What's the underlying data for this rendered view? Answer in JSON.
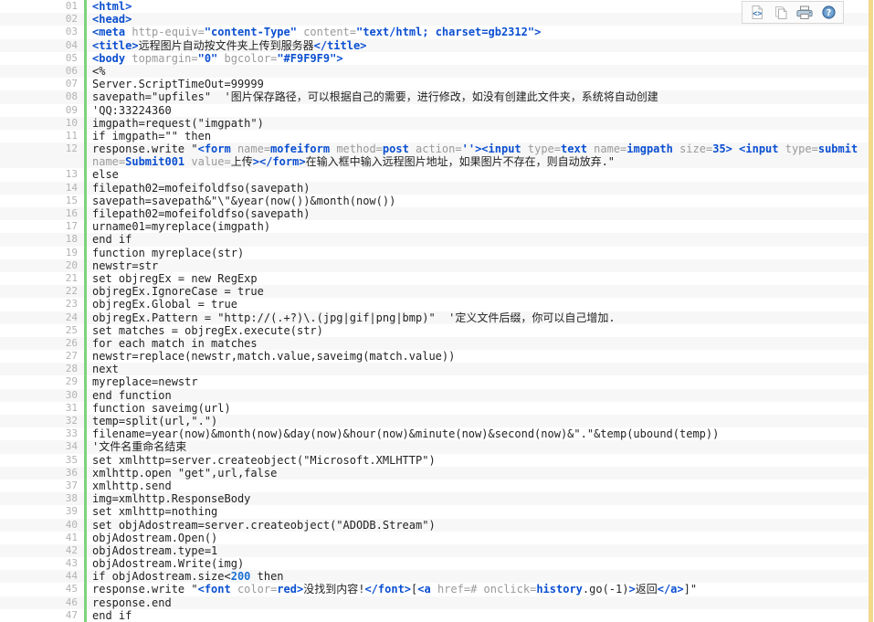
{
  "toolbar": {
    "buttons": [
      {
        "name": "view-source-icon",
        "label": "View Source",
        "glyph": "code-page-icon"
      },
      {
        "name": "copy-icon",
        "label": "Copy",
        "glyph": "copy-pages-icon"
      },
      {
        "name": "print-icon",
        "label": "Print",
        "glyph": "printer-icon"
      },
      {
        "name": "help-icon",
        "label": "Help",
        "glyph": "question-circle-icon"
      }
    ]
  },
  "colors": {
    "edge_bar": "#f2d98c",
    "gutter_accent": "#7ed37e",
    "line_number": "#b3b3b3",
    "row_alt": "#f7f7f7",
    "tag": "#0b4fd1",
    "attribute": "#9a9a9a",
    "value": "#0b4fd1",
    "number": "#1a6fd4",
    "text": "#222222"
  },
  "code": {
    "language": "asp-vbscript",
    "first_line": 1,
    "last_line": 47,
    "lines": [
      {
        "n": "01",
        "tokens": [
          {
            "t": "tag",
            "s": "<html>"
          }
        ]
      },
      {
        "n": "02",
        "tokens": [
          {
            "t": "tag",
            "s": "<head>"
          }
        ]
      },
      {
        "n": "03",
        "tokens": [
          {
            "t": "tag",
            "s": "<meta"
          },
          {
            "t": "attr",
            "s": " http-equiv="
          },
          {
            "t": "val",
            "s": "\"content-Type\""
          },
          {
            "t": "attr",
            "s": " content="
          },
          {
            "t": "val",
            "s": "\"text/html; charset=gb2312\""
          },
          {
            "t": "tag",
            "s": ">"
          }
        ]
      },
      {
        "n": "04",
        "tokens": [
          {
            "t": "tag",
            "s": "<title>"
          },
          {
            "t": "plain",
            "s": "远程图片自动按文件夹上传到服务器"
          },
          {
            "t": "tag",
            "s": "</title>"
          }
        ]
      },
      {
        "n": "05",
        "tokens": [
          {
            "t": "tag",
            "s": "<body"
          },
          {
            "t": "attr",
            "s": " topmargin="
          },
          {
            "t": "val",
            "s": "\"0\""
          },
          {
            "t": "attr",
            "s": " bgcolor="
          },
          {
            "t": "val",
            "s": "\"#F9F9F9\""
          },
          {
            "t": "tag",
            "s": ">"
          }
        ]
      },
      {
        "n": "06",
        "tokens": [
          {
            "t": "plain",
            "s": "<%"
          }
        ]
      },
      {
        "n": "07",
        "tokens": [
          {
            "t": "plain",
            "s": "Server.ScriptTimeOut=99999"
          }
        ]
      },
      {
        "n": "08",
        "tokens": [
          {
            "t": "plain",
            "s": "savepath=\"upfiles\"  '图片保存路径，可以根据自己的需要，进行修改，如没有创建此文件夹，系统将自动创建"
          }
        ]
      },
      {
        "n": "09",
        "tokens": [
          {
            "t": "plain",
            "s": "'QQ:33224360"
          }
        ]
      },
      {
        "n": "10",
        "tokens": [
          {
            "t": "plain",
            "s": "imgpath=request(\"imgpath\")"
          }
        ]
      },
      {
        "n": "11",
        "tokens": [
          {
            "t": "plain",
            "s": "if imgpath=\"\" then"
          }
        ]
      },
      {
        "n": "12",
        "wrapped": true,
        "tokens": [
          {
            "t": "plain",
            "s": "response.write \""
          },
          {
            "t": "tag",
            "s": "<form"
          },
          {
            "t": "attr",
            "s": " name="
          },
          {
            "t": "val",
            "s": "mofeiform"
          },
          {
            "t": "attr",
            "s": " method="
          },
          {
            "t": "val",
            "s": "post"
          },
          {
            "t": "attr",
            "s": " action="
          },
          {
            "t": "val",
            "s": "''"
          },
          {
            "t": "tag",
            "s": ">"
          },
          {
            "t": "tag",
            "s": "<input"
          },
          {
            "t": "attr",
            "s": " type="
          },
          {
            "t": "val",
            "s": "text"
          },
          {
            "t": "attr",
            "s": " name="
          },
          {
            "t": "val",
            "s": "imgpath"
          },
          {
            "t": "attr",
            "s": " size="
          },
          {
            "t": "val",
            "s": "35"
          },
          {
            "t": "tag",
            "s": ">"
          },
          {
            "t": "plain",
            "s": " "
          },
          {
            "t": "tag",
            "s": "<input"
          },
          {
            "t": "attr",
            "s": " type="
          },
          {
            "t": "val",
            "s": "submit"
          },
          {
            "t": "attr",
            "s": " name="
          },
          {
            "t": "val",
            "s": "Submit001"
          },
          {
            "t": "attr",
            "s": " value="
          },
          {
            "t": "plain",
            "s": "上传"
          },
          {
            "t": "tag",
            "s": ">"
          },
          {
            "t": "tag",
            "s": "</form>"
          },
          {
            "t": "plain",
            "s": "在输入框中输入远程图片地址，如果图片不存在，则自动放弃.\""
          }
        ]
      },
      {
        "n": "13",
        "tokens": [
          {
            "t": "plain",
            "s": "else"
          }
        ]
      },
      {
        "n": "14",
        "tokens": [
          {
            "t": "plain",
            "s": "filepath02=mofeifoldfso(savepath)"
          }
        ]
      },
      {
        "n": "15",
        "tokens": [
          {
            "t": "plain",
            "s": "savepath=savepath&\"\\\"&year(now())&month(now())"
          }
        ]
      },
      {
        "n": "16",
        "tokens": [
          {
            "t": "plain",
            "s": "filepath02=mofeifoldfso(savepath)"
          }
        ]
      },
      {
        "n": "17",
        "tokens": [
          {
            "t": "plain",
            "s": "urname01=myreplace(imgpath)"
          }
        ]
      },
      {
        "n": "18",
        "tokens": [
          {
            "t": "plain",
            "s": "end if"
          }
        ]
      },
      {
        "n": "19",
        "tokens": [
          {
            "t": "plain",
            "s": "function myreplace(str)"
          }
        ]
      },
      {
        "n": "20",
        "tokens": [
          {
            "t": "plain",
            "s": "newstr=str"
          }
        ]
      },
      {
        "n": "21",
        "tokens": [
          {
            "t": "plain",
            "s": "set objregEx = new RegExp"
          }
        ]
      },
      {
        "n": "22",
        "tokens": [
          {
            "t": "plain",
            "s": "objregEx.IgnoreCase = true"
          }
        ]
      },
      {
        "n": "23",
        "tokens": [
          {
            "t": "plain",
            "s": "objregEx.Global = true"
          }
        ]
      },
      {
        "n": "24",
        "tokens": [
          {
            "t": "plain",
            "s": "objregEx.Pattern = \"http://(.+?)\\.(jpg|gif|png|bmp)\"  '定义文件后缀，你可以自己增加."
          }
        ]
      },
      {
        "n": "25",
        "tokens": [
          {
            "t": "plain",
            "s": "set matches = objregEx.execute(str)"
          }
        ]
      },
      {
        "n": "26",
        "tokens": [
          {
            "t": "plain",
            "s": "for each match in matches"
          }
        ]
      },
      {
        "n": "27",
        "tokens": [
          {
            "t": "plain",
            "s": "newstr=replace(newstr,match.value,saveimg(match.value))"
          }
        ]
      },
      {
        "n": "28",
        "tokens": [
          {
            "t": "plain",
            "s": "next"
          }
        ]
      },
      {
        "n": "29",
        "tokens": [
          {
            "t": "plain",
            "s": "myreplace=newstr"
          }
        ]
      },
      {
        "n": "30",
        "tokens": [
          {
            "t": "plain",
            "s": "end function"
          }
        ]
      },
      {
        "n": "31",
        "tokens": [
          {
            "t": "plain",
            "s": "function saveimg(url)"
          }
        ]
      },
      {
        "n": "32",
        "tokens": [
          {
            "t": "plain",
            "s": "temp=split(url,\".\")"
          }
        ]
      },
      {
        "n": "33",
        "tokens": [
          {
            "t": "plain",
            "s": "filename=year(now)&month(now)&day(now)&hour(now)&minute(now)&second(now)&\".\"&temp(ubound(temp))"
          }
        ]
      },
      {
        "n": "34",
        "tokens": [
          {
            "t": "plain",
            "s": "'文件名重命名结束"
          }
        ]
      },
      {
        "n": "35",
        "tokens": [
          {
            "t": "plain",
            "s": "set xmlhttp=server.createobject(\"Microsoft.XMLHTTP\")"
          }
        ]
      },
      {
        "n": "36",
        "tokens": [
          {
            "t": "plain",
            "s": "xmlhttp.open \"get\",url,false"
          }
        ]
      },
      {
        "n": "37",
        "tokens": [
          {
            "t": "plain",
            "s": "xmlhttp.send"
          }
        ]
      },
      {
        "n": "38",
        "tokens": [
          {
            "t": "plain",
            "s": "img=xmlhttp.ResponseBody"
          }
        ]
      },
      {
        "n": "39",
        "tokens": [
          {
            "t": "plain",
            "s": "set xmlhttp=nothing"
          }
        ]
      },
      {
        "n": "40",
        "tokens": [
          {
            "t": "plain",
            "s": "set objAdostream=server.createobject(\"ADODB.Stream\")"
          }
        ]
      },
      {
        "n": "41",
        "tokens": [
          {
            "t": "plain",
            "s": "objAdostream.Open()"
          }
        ]
      },
      {
        "n": "42",
        "tokens": [
          {
            "t": "plain",
            "s": "objAdostream.type=1"
          }
        ]
      },
      {
        "n": "43",
        "tokens": [
          {
            "t": "plain",
            "s": "objAdostream.Write(img)"
          }
        ]
      },
      {
        "n": "44",
        "tokens": [
          {
            "t": "plain",
            "s": "if objAdostream.size<"
          },
          {
            "t": "num",
            "s": "200"
          },
          {
            "t": "plain",
            "s": " then"
          }
        ]
      },
      {
        "n": "45",
        "tokens": [
          {
            "t": "plain",
            "s": "response.write \""
          },
          {
            "t": "tag",
            "s": "<font"
          },
          {
            "t": "attr",
            "s": " color="
          },
          {
            "t": "val",
            "s": "red"
          },
          {
            "t": "tag",
            "s": ">"
          },
          {
            "t": "plain",
            "s": "没找到内容!"
          },
          {
            "t": "tag",
            "s": "</font>"
          },
          {
            "t": "plain",
            "s": "["
          },
          {
            "t": "tag",
            "s": "<a"
          },
          {
            "t": "attr",
            "s": " href=#"
          },
          {
            "t": "attr",
            "s": " onclick="
          },
          {
            "t": "val",
            "s": "history"
          },
          {
            "t": "plain",
            "s": ".go(-1)"
          },
          {
            "t": "tag",
            "s": ">"
          },
          {
            "t": "plain",
            "s": "返回"
          },
          {
            "t": "tag",
            "s": "</a>"
          },
          {
            "t": "plain",
            "s": "]\""
          }
        ]
      },
      {
        "n": "46",
        "tokens": [
          {
            "t": "plain",
            "s": "response.end"
          }
        ]
      },
      {
        "n": "47",
        "tokens": [
          {
            "t": "plain",
            "s": "end if"
          }
        ]
      }
    ]
  }
}
